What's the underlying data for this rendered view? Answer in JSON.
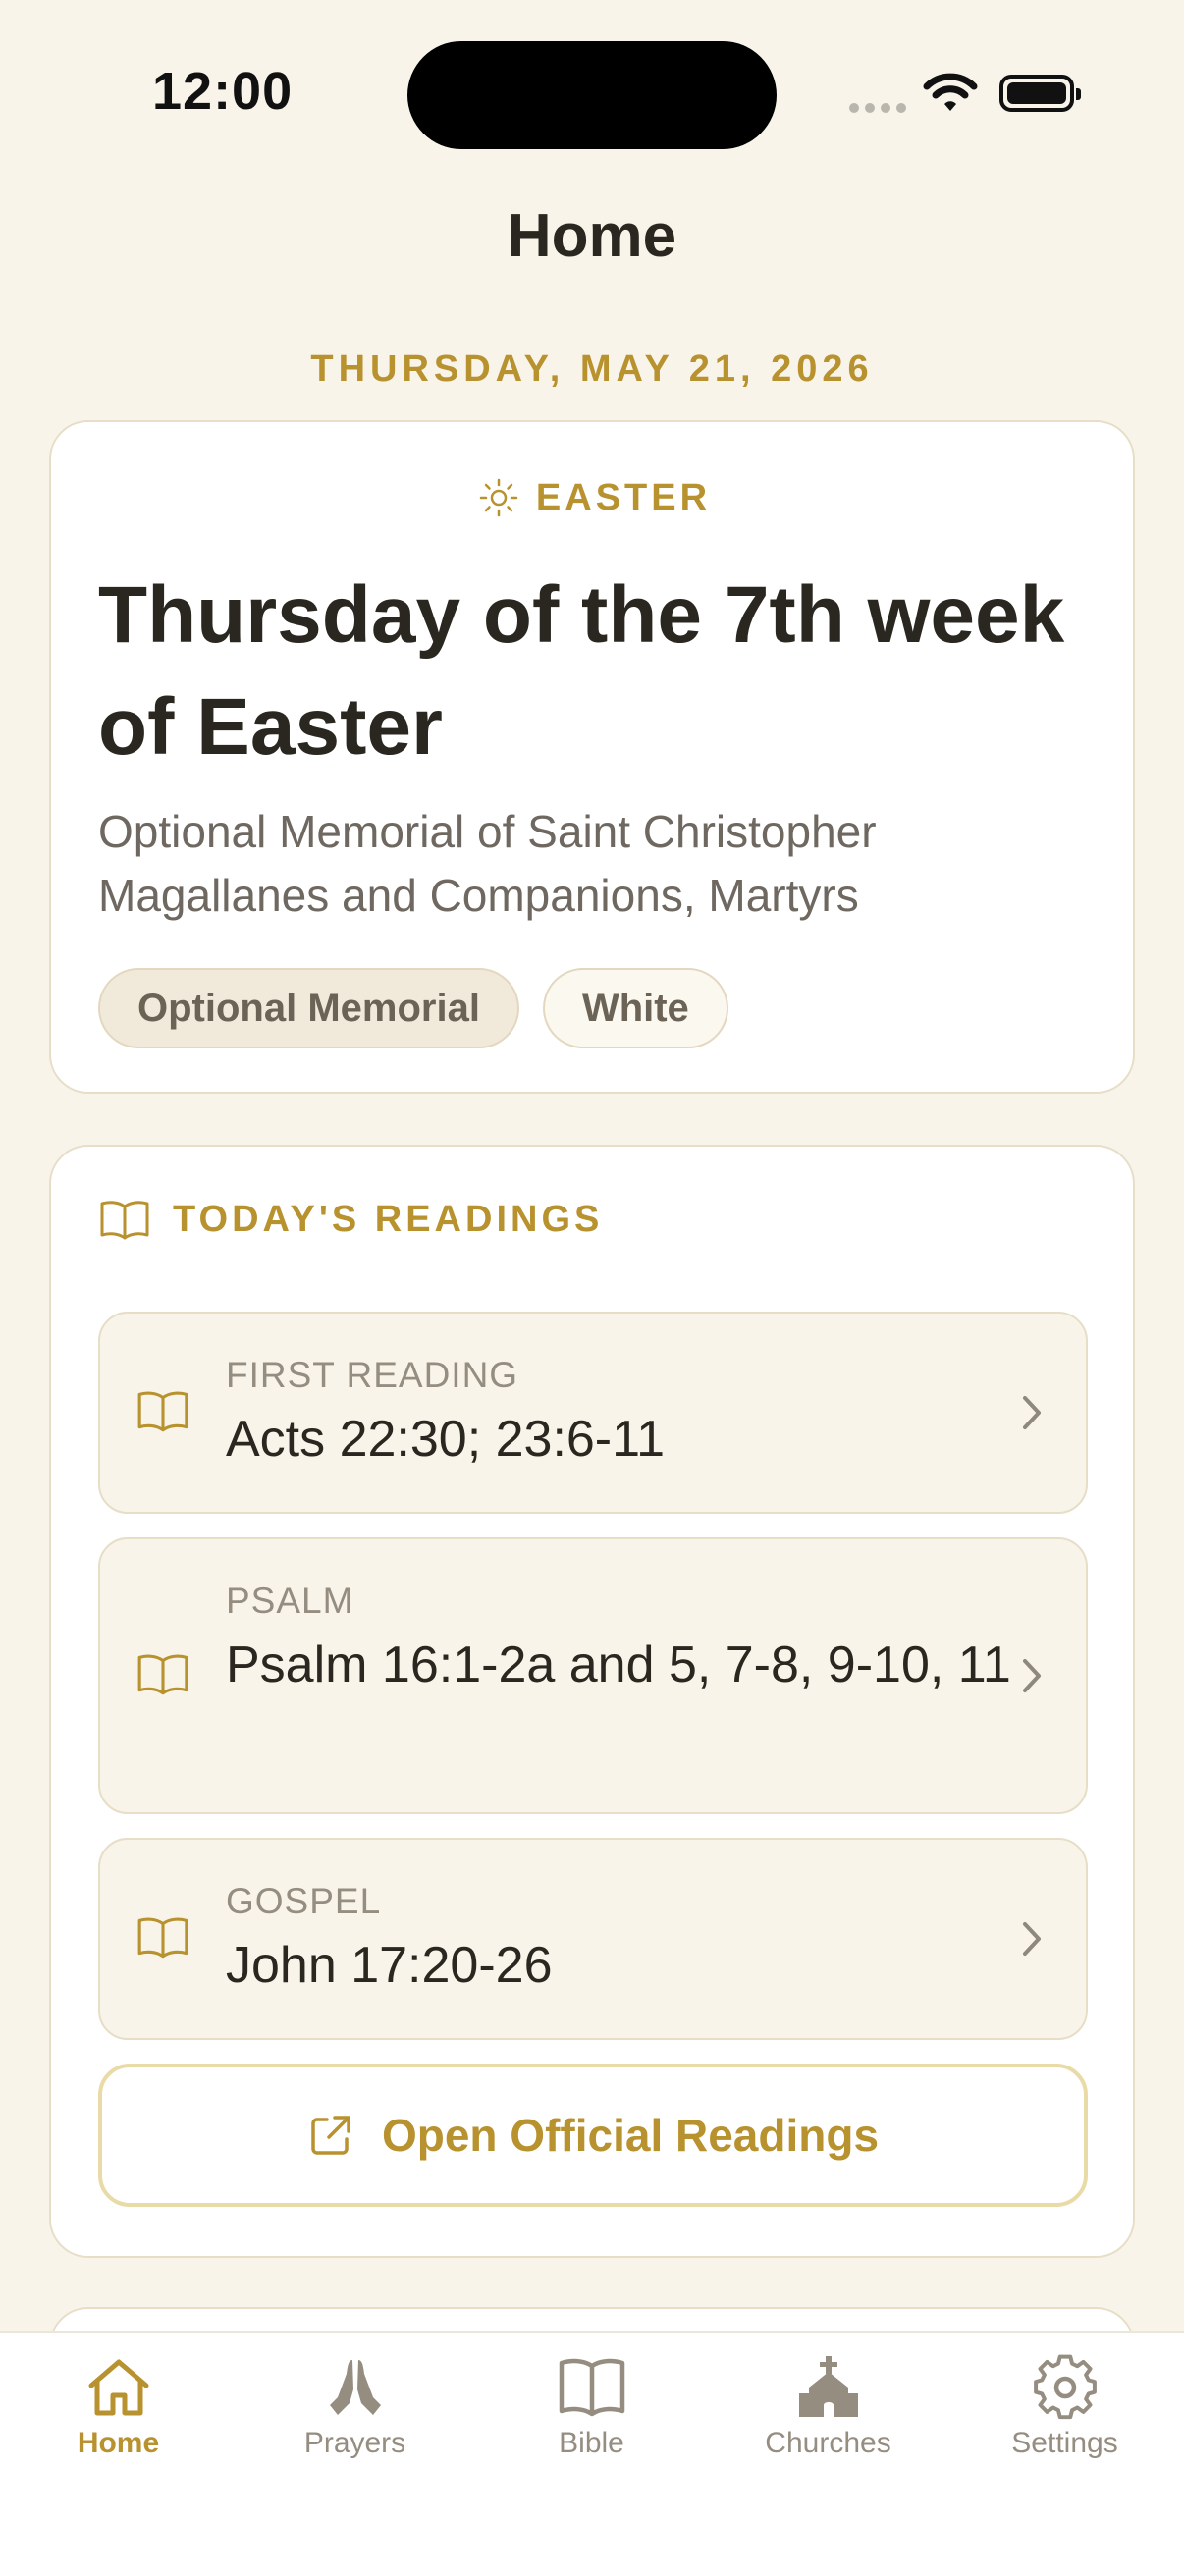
{
  "status_bar": {
    "time": "12:00"
  },
  "header": {
    "title": "Home"
  },
  "date": "THURSDAY, MAY 21, 2026",
  "day_card": {
    "season": "EASTER",
    "title": "Thursday of the 7th week of Easter",
    "memorial": "Optional Memorial of Saint Christopher Magallanes and Companions, Martyrs",
    "rank_chip": "Optional Memorial",
    "color_chip": "White"
  },
  "readings": {
    "heading": "TODAY'S READINGS",
    "items": [
      {
        "label": "FIRST READING",
        "reference": "Acts 22:30; 23:6-11"
      },
      {
        "label": "PSALM",
        "reference": "Psalm 16:1-2a and 5, 7-8, 9-10, 11"
      },
      {
        "label": "GOSPEL",
        "reference": "John 17:20-26"
      }
    ],
    "open_button": "Open Official Readings"
  },
  "tabbar": {
    "tabs": [
      {
        "label": "Home",
        "icon": "house-icon",
        "active": true
      },
      {
        "label": "Prayers",
        "icon": "praying-hands-icon",
        "active": false
      },
      {
        "label": "Bible",
        "icon": "book-icon",
        "active": false
      },
      {
        "label": "Churches",
        "icon": "church-icon",
        "active": false
      },
      {
        "label": "Settings",
        "icon": "gear-icon",
        "active": false
      }
    ]
  },
  "colors": {
    "accent": "#B8922E",
    "background": "#F8F4EA",
    "text": "#2A2720",
    "muted": "#958D80"
  }
}
